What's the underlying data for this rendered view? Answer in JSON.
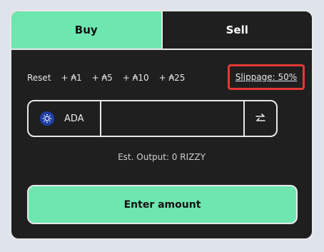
{
  "tabs": {
    "buy": "Buy",
    "sell": "Sell"
  },
  "quick_amounts": [
    "Reset",
    "+ ₳1",
    "+ ₳5",
    "+ ₳10",
    "+ ₳25"
  ],
  "slippage": {
    "label": "Slippage: 50%"
  },
  "input": {
    "token": "ADA",
    "value": ""
  },
  "estimate": "Est. Output: 0 RIZZY",
  "action_button": "Enter amount",
  "colors": {
    "accent": "#6ee6b0",
    "panel": "#1f1f1f",
    "highlight": "#e53935",
    "token_blue": "#1e3ea8"
  },
  "icons": {
    "token": "cardano-icon",
    "swap": "swap-arrows-icon"
  }
}
